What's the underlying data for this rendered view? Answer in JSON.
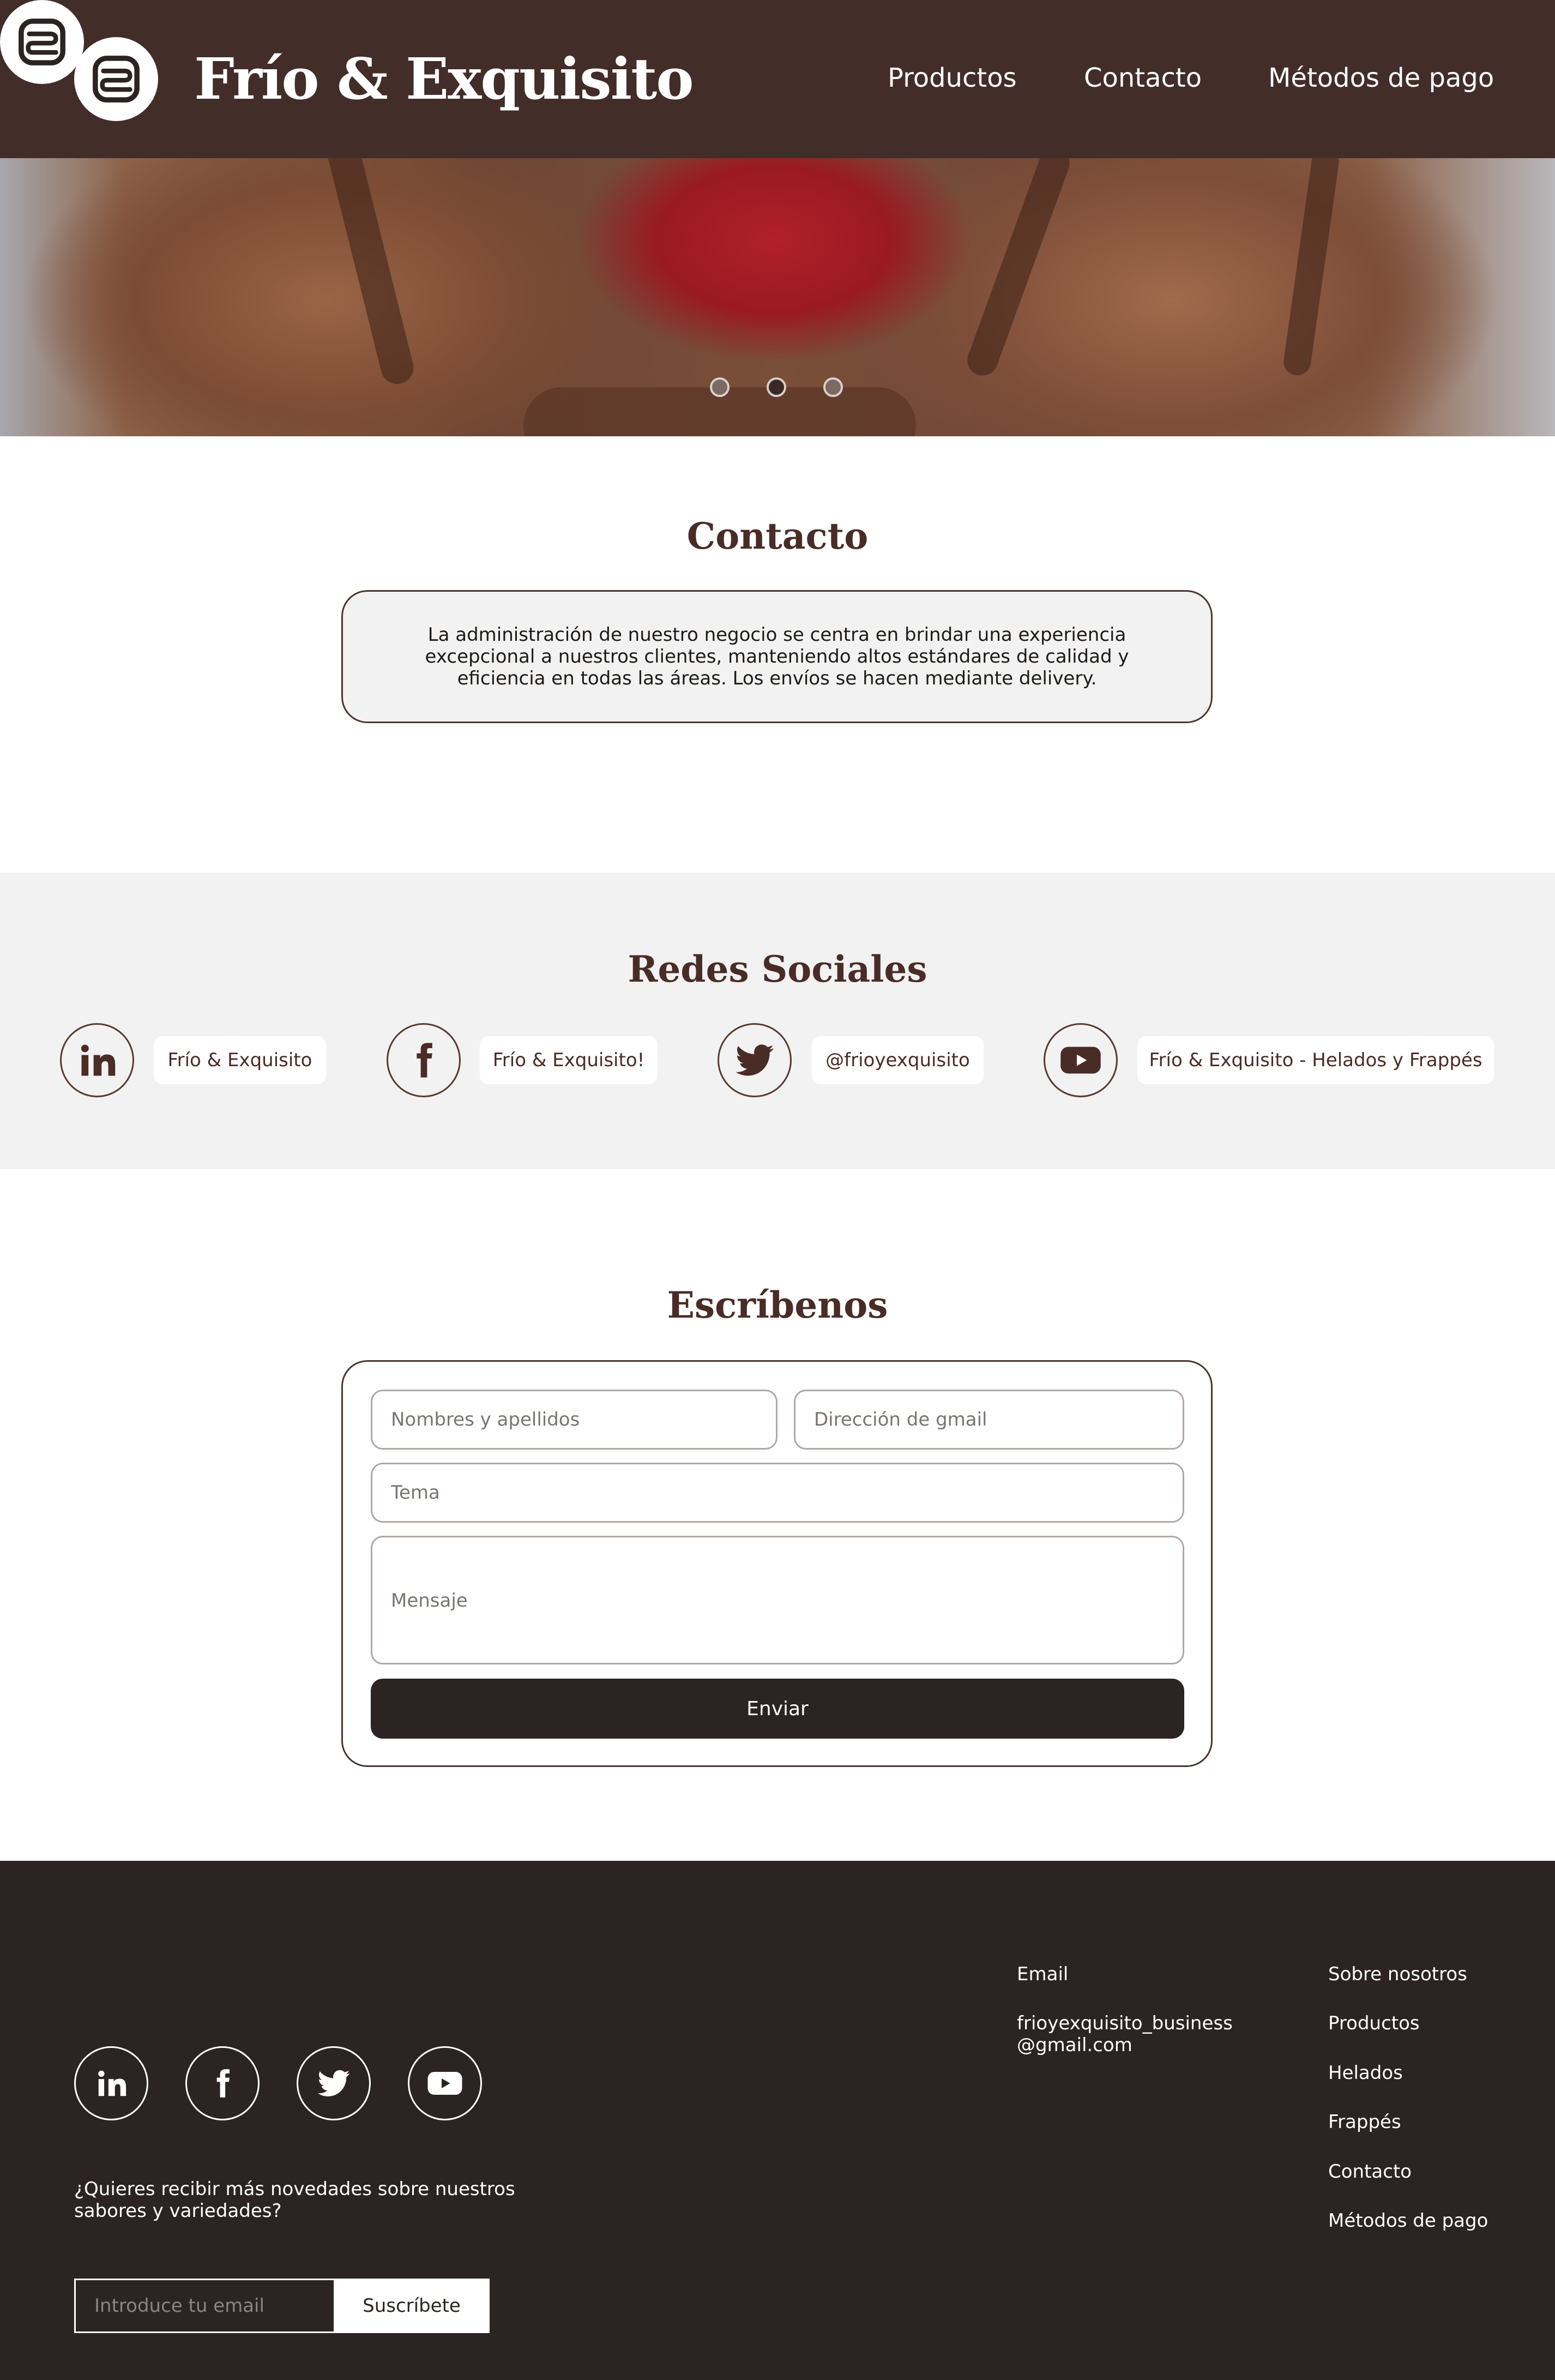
{
  "header": {
    "brand": "Frío & Exquisito",
    "nav": [
      {
        "label": "Productos"
      },
      {
        "label": "Contacto"
      },
      {
        "label": "Métodos de pago"
      }
    ],
    "colors": {
      "background": "#422d29",
      "text": "#ffffff"
    }
  },
  "carousel": {
    "slides": 3,
    "active_index": 1,
    "image": "chocolate ice cream with strawberry"
  },
  "contact": {
    "title": "Contacto",
    "text": "La administración de nuestro negocio se centra en brindar una experiencia excepcional a nuestros clientes, manteniendo altos estándares de calidad y eficiencia en todas las áreas. Los envíos se hacen mediante delivery."
  },
  "social": {
    "title": "Redes Sociales",
    "items": [
      {
        "icon": "linkedin-icon",
        "label": "Frío & Exquisito"
      },
      {
        "icon": "facebook-icon",
        "label": "Frío & Exquisito!"
      },
      {
        "icon": "twitter-icon",
        "label": "@frioyexquisito"
      },
      {
        "icon": "youtube-icon",
        "label": "Frío & Exquisito - Helados y Frappés"
      }
    ]
  },
  "form": {
    "title": "Escríbenos",
    "name_placeholder": "Nombres y apellidos",
    "email_placeholder": "Dirección de gmail",
    "subject_placeholder": "Tema",
    "message_placeholder": "Mensaje",
    "submit_label": "Enviar"
  },
  "footer": {
    "social_icons": [
      "linkedin-icon",
      "facebook-icon",
      "twitter-icon",
      "youtube-icon"
    ],
    "newsletter_text_line1": "¿Quieres recibir más novedades sobre nuestros",
    "newsletter_text_line2": "sabores y variedades?",
    "newsletter_placeholder": "Introduce tu email",
    "newsletter_button": "Suscríbete",
    "email_label": "Email",
    "email_line1": "frioyexquisito_business",
    "email_line2": "@gmail.com",
    "links": [
      {
        "label": "Sobre nosotros"
      },
      {
        "label": "Productos"
      },
      {
        "label": "Helados"
      },
      {
        "label": "Frappés"
      },
      {
        "label": "Contacto"
      },
      {
        "label": "Métodos de pago"
      }
    ],
    "colors": {
      "background": "#2b2422",
      "text": "#ffffff"
    }
  },
  "colors": {
    "accent_brown": "#4a2c26",
    "light_gray": "#f2f2f2"
  }
}
